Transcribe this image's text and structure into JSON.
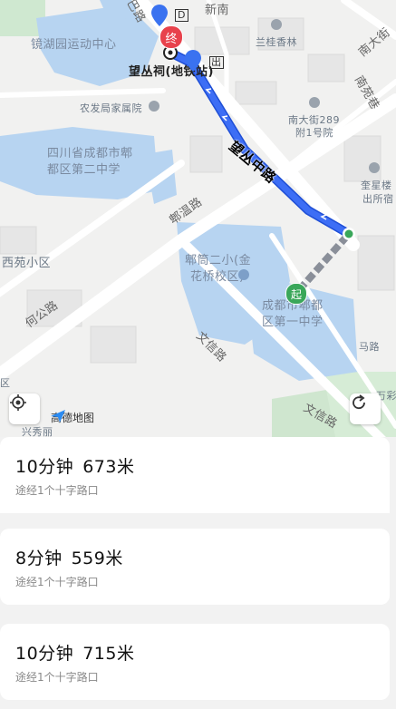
{
  "map": {
    "labels": {
      "jinghu_park": "镜湖园运动中心",
      "wangcong_station": "望丛祠(地铁站)",
      "exit_tag": "出",
      "entrance_d": "D",
      "guishan": "兰桂香林",
      "agri_bureau": "农发局家属院",
      "pidu_no2": "四川省成都市郫",
      "pidu_no2_b": "都区第二中学",
      "nandajie": "南大街289",
      "nandajie_b": "附1号院",
      "pitong_no2": "郫筒二小(金",
      "pitong_no2_b": "花桥校区)",
      "pidu_no1": "成都市郫都",
      "pidu_no1_b": "区第一中学",
      "xiyuan": "西苑小区",
      "road_hegong": "何公路",
      "road_piwen": "郫温路",
      "road_wenxin": "文信路",
      "road_wenxin2": "文信路",
      "road_wangcong": "望丛中路",
      "road_nanyuan": "南苑巷",
      "road_nandajie": "南大街",
      "road_xinnan": "新南",
      "kuixing": "奎星楼",
      "kuixing_b": "出所宿",
      "zone_left": "区",
      "wancai": "万彩",
      "xingxiu": "兴秀丽",
      "zhu_road": "马路",
      "road_top": "巴路"
    },
    "marker_start": "起",
    "marker_end": "终",
    "brand": "高德地图",
    "locate_icon": "locate-icon",
    "refresh_icon": "refresh-icon"
  },
  "routes": [
    {
      "time": "10分钟",
      "distance": "673米",
      "detail": "途经1个十字路口"
    },
    {
      "time": "8分钟",
      "distance": "559米",
      "detail": "途经1个十字路口"
    },
    {
      "time": "10分钟",
      "distance": "715米",
      "detail": "途经1个十字路口"
    }
  ],
  "colors": {
    "route": "#3d6ef5",
    "walk": "#8a8f99",
    "end": "#e8424c",
    "start": "#3aa75a",
    "water": "#b7d4f1"
  }
}
